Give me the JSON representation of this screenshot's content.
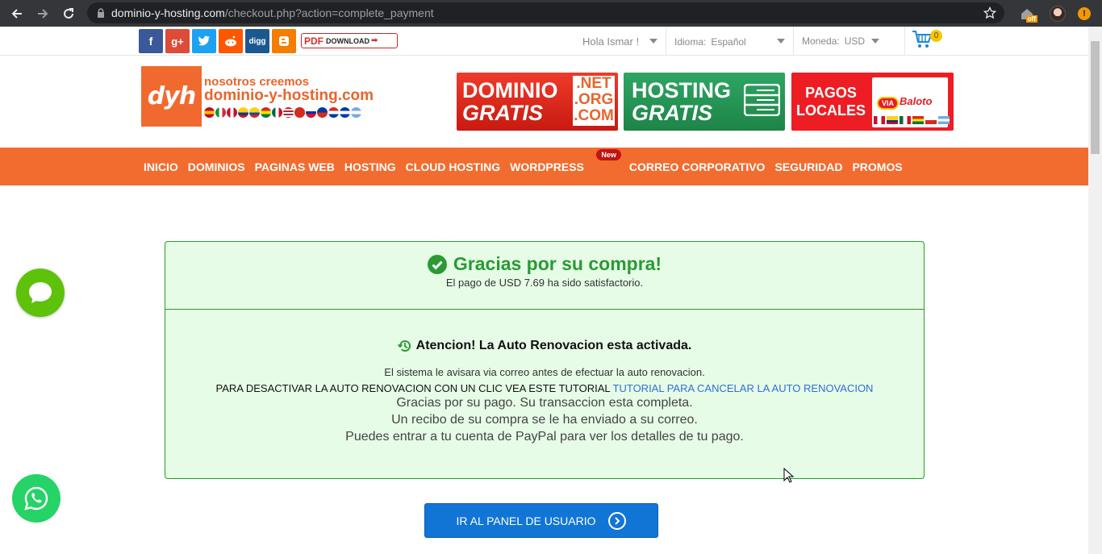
{
  "browser": {
    "url_host": "dominio-y-hosting.com",
    "url_path": "/checkout.php?action=complete_payment",
    "ext_badge": "off"
  },
  "topbar": {
    "social": [
      {
        "name": "facebook",
        "glyph": "f",
        "color": "#3b5998"
      },
      {
        "name": "google-plus",
        "glyph": "g+",
        "color": "#dd4b39"
      },
      {
        "name": "twitter",
        "glyph": "t",
        "color": "#1da1f2"
      },
      {
        "name": "reddit",
        "glyph": "r",
        "color": "#ff5700"
      },
      {
        "name": "digg",
        "glyph": "digg",
        "color": "#1b5891"
      },
      {
        "name": "blogger",
        "glyph": "B",
        "color": "#f57d00"
      }
    ],
    "pdf_label": "PDF",
    "download_label": "DOWNLOAD",
    "greeting": "Hola Ismar !",
    "language_label": "Idioma:",
    "language_value": "Español",
    "currency_label": "Moneda:",
    "currency_value": "USD",
    "cart_count": "0"
  },
  "header": {
    "logo_mark": "dyh",
    "logo_line1": "nosotros creemos",
    "logo_line2": "dominio-y-hosting.com",
    "banner_dominio_1": "DOMINIO",
    "banner_dominio_2": "GRATIS",
    "banner_ext": [
      ".NET",
      ".ORG",
      ".COM"
    ],
    "banner_hosting_1": "HOSTING",
    "banner_hosting_2": "GRATIS",
    "banner_pagos_1": "PAGOS",
    "banner_pagos_2": "LOCALES",
    "banner_pagos_logo_1": "VIA",
    "banner_pagos_logo_2": "Baloto"
  },
  "menu": {
    "items": [
      "INICIO",
      "DOMINIOS",
      "PAGINAS WEB",
      "HOSTING",
      "CLOUD HOSTING",
      "WORDPRESS",
      "CORREO CORPORATIVO",
      "SEGURIDAD",
      "PROMOS"
    ],
    "new_badge": "New"
  },
  "confirmation": {
    "title": "Gracias por su compra!",
    "paid_text": "El pago de USD 7.69 ha sido satisfactorio.",
    "attention": "Atencion! La Auto Renovacion esta activada.",
    "system_notice": "El sistema le avisara via correo antes de efectuar la auto renovacion.",
    "deactivate_text": "PARA DESACTIVAR LA AUTO RENOVACION CON UN CLIC VEA ESTE TUTORIAL",
    "tutorial_link": "TUTORIAL PARA CANCELAR LA AUTO RENOVACION",
    "receipt_lines": [
      "Gracias por su pago. Su transaccion esta completa.",
      "Un recibo de su compra se le ha enviado a su correo.",
      "Puedes entrar a tu cuenta de PayPal para ver los detalles de tu pago."
    ],
    "panel_button": "IR AL PANEL DE USUARIO"
  },
  "colors": {
    "brand_orange": "#f26c30",
    "success_green": "#2a9a35",
    "button_blue": "#1175d6"
  }
}
